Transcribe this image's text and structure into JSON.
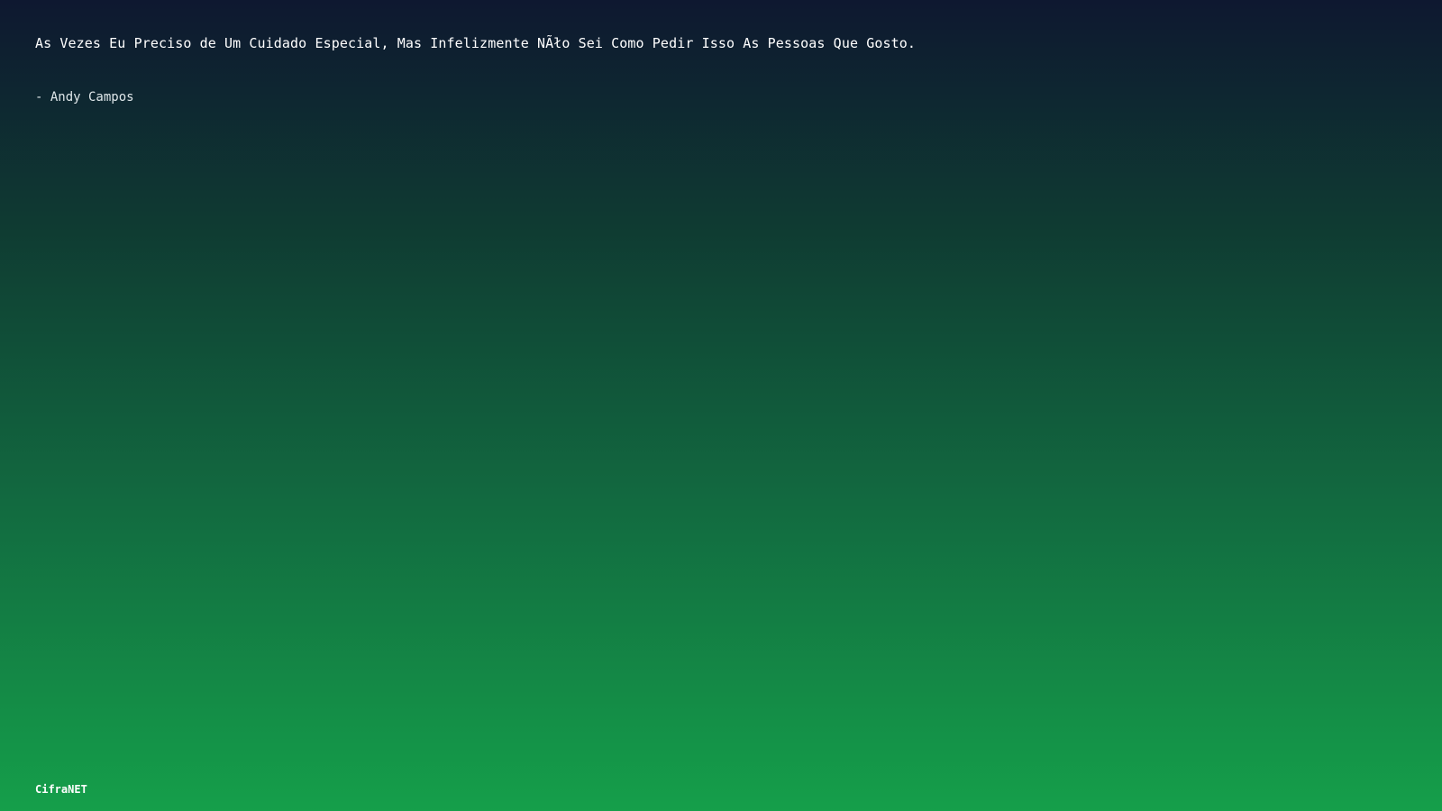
{
  "quote": {
    "text": "As Vezes Eu Preciso de Um Cuidado Especial, Mas Infelizmente NÃło Sei Como Pedir Isso As Pessoas Que Gosto.",
    "author": "- Andy Campos"
  },
  "footer": {
    "brand": "CifraNET"
  },
  "colors": {
    "gradient_top": "#0e1830",
    "gradient_bottom": "#159f4a",
    "text": "#ffffff"
  }
}
